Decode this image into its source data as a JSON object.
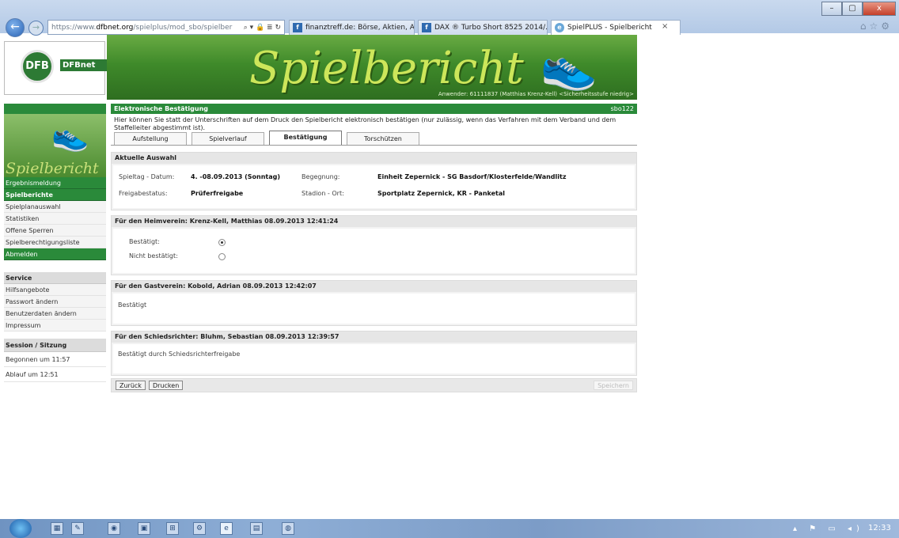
{
  "browser": {
    "window_controls": [
      "–",
      "▢",
      "x"
    ],
    "address": {
      "prefix": "https://www.",
      "domain": "dfbnet.org",
      "rest": "/spielplus/mod_sbo/spielber"
    },
    "address_icons": "⌕ ▾ 🔒 ≣ ↻",
    "tabs": [
      {
        "label": "finanztreff.de: Börse, Aktien, A...",
        "icon": "f"
      },
      {
        "label": "DAX ® Turbo Short 8525 2014/...",
        "icon": "f"
      },
      {
        "label": "SpielPLUS - Spielbericht",
        "icon": "e"
      }
    ],
    "tab_close": "×",
    "toolbar_icons": "⌂☆⚙"
  },
  "header": {
    "logo_text": "DFBnet",
    "logo_badge": "DFB",
    "banner_title": "Spielbericht",
    "user_info": "Anwender: 61111837 (Matthias Krenz-Kell) <Sicherheitsstufe niedrig>"
  },
  "sidebar": {
    "image_word": "Spielbericht",
    "items": [
      {
        "label": "Ergebnismeldung",
        "style": "green"
      },
      {
        "label": "Spielberichte",
        "style": "green bold"
      },
      {
        "label": "Spielplanauswahl",
        "style": ""
      },
      {
        "label": "Statistiken",
        "style": ""
      },
      {
        "label": "Offene Sperren",
        "style": ""
      },
      {
        "label": "Spielberechtigungsliste",
        "style": ""
      },
      {
        "label": "Abmelden",
        "style": "green"
      }
    ],
    "service_title": "Service",
    "service_items": [
      "Hilfsangebote",
      "Passwort ändern",
      "Benutzerdaten ändern",
      "Impressum"
    ],
    "session_title": "Session / Sitzung",
    "session_items": [
      "Begonnen um 11:57",
      "Ablauf um 12:51"
    ]
  },
  "main": {
    "title": "Elektronische Bestätigung",
    "code": "sbo122",
    "intro": "Hier können Sie statt der Unterschriften auf dem Druck den Spielbericht elektronisch bestätigen (nur zulässig, wenn das Verfahren mit dem Verband und dem Staffelleiter abgestimmt ist).",
    "tabs": [
      {
        "label": "Aufstellung",
        "active": false
      },
      {
        "label": "Spielverlauf",
        "active": false
      },
      {
        "label": "Bestätigung",
        "active": true
      },
      {
        "label": "Torschützen",
        "active": false
      }
    ],
    "auswahl": {
      "title": "Aktuelle Auswahl",
      "spieltag_label": "Spieltag - Datum:",
      "spieltag_value": "4. -08.09.2013 (Sonntag)",
      "begegnung_label": "Begegnung:",
      "begegnung_value": "Einheit Zepernick - SG Basdorf/Klosterfelde/Wandlitz",
      "freigabe_label": "Freigabestatus:",
      "freigabe_value": "Prüferfreigabe",
      "stadion_label": "Stadion - Ort:",
      "stadion_value": "Sportplatz Zepernick, KR - Panketal"
    },
    "heim": {
      "title": "Für den Heimverein: Krenz-Kell, Matthias 08.09.2013 12:41:24",
      "options": [
        {
          "label": "Bestätigt:",
          "selected": true
        },
        {
          "label": "Nicht bestätigt:",
          "selected": false
        }
      ]
    },
    "gast": {
      "title": "Für den Gastverein: Kobold, Adrian 08.09.2013 12:42:07",
      "text": "Bestätigt"
    },
    "schiri": {
      "title": "Für den Schiedsrichter: Bluhm, Sebastian 08.09.2013 12:39:57",
      "text": "Bestätigt durch Schiedsrichterfreigabe"
    },
    "buttons": {
      "back": "Zurück",
      "print": "Drucken",
      "save": "Speichern"
    }
  },
  "taskbar": {
    "icons": [
      "▦",
      "✎",
      "◉",
      "▣",
      "⊞",
      "⚙",
      "e",
      "▤",
      "◍"
    ],
    "tray": "▴ ⚑ ▭ ◂)",
    "clock": "12:33"
  }
}
